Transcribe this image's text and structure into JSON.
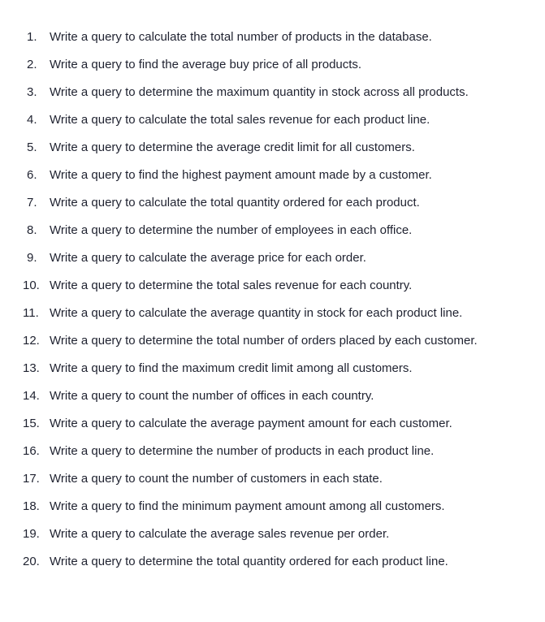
{
  "items": [
    {
      "number": "1.",
      "text": "Write a query to calculate the total number of products in the database."
    },
    {
      "number": "2.",
      "text": "Write a query to find the average buy price of all products."
    },
    {
      "number": "3.",
      "text": "Write a query to determine the maximum quantity in stock across all products."
    },
    {
      "number": "4.",
      "text": "Write a query to calculate the total sales revenue for each product line."
    },
    {
      "number": "5.",
      "text": "Write a query to determine the average credit limit for all customers."
    },
    {
      "number": "6.",
      "text": "Write a query to find the highest payment amount made by a customer."
    },
    {
      "number": "7.",
      "text": "Write a query to calculate the total quantity ordered for each product."
    },
    {
      "number": "8.",
      "text": "Write a query to determine the number of employees in each office."
    },
    {
      "number": "9.",
      "text": "Write a query to calculate the average price for each order."
    },
    {
      "number": "10.",
      "text": "Write a query to determine the total sales revenue for each country."
    },
    {
      "number": "11.",
      "text": "Write a query to calculate the average quantity in stock for each product line."
    },
    {
      "number": "12.",
      "text": "Write a query to determine the total number of orders placed by each customer."
    },
    {
      "number": "13.",
      "text": "Write a query to find the maximum credit limit among all customers."
    },
    {
      "number": "14.",
      "text": "Write a query to count the number of offices in each country."
    },
    {
      "number": "15.",
      "text": "Write a query to calculate the average payment amount for each customer."
    },
    {
      "number": "16.",
      "text": "Write a query to determine the number of products in each product line."
    },
    {
      "number": "17.",
      "text": "Write a query to count the number of customers in each state."
    },
    {
      "number": "18.",
      "text": "Write a query to find the minimum payment amount among all customers."
    },
    {
      "number": "19.",
      "text": "Write a query to calculate the average sales revenue per order."
    },
    {
      "number": "20.",
      "text": "Write a query to determine the total quantity ordered for each product line."
    }
  ]
}
